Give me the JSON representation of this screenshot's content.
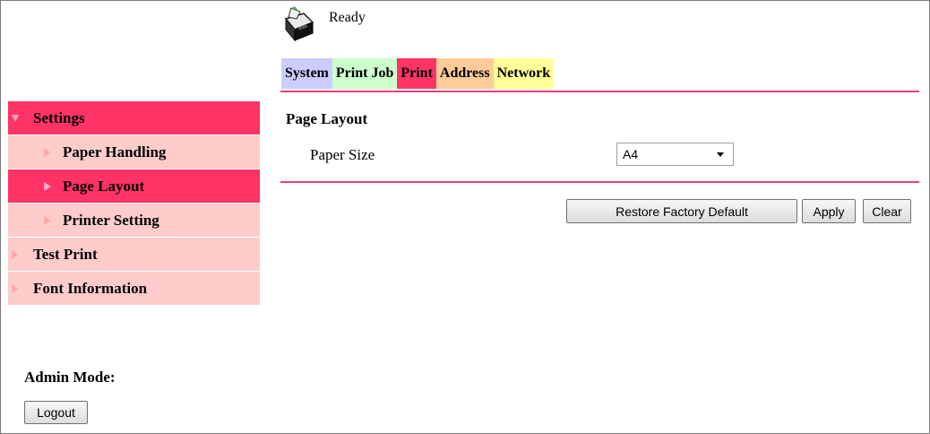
{
  "status": {
    "text": "Ready",
    "icon": "printer-status-icon"
  },
  "tabs": [
    {
      "label": "System",
      "color": "#ccccff"
    },
    {
      "label": "Print Job",
      "color": "#ccffcc"
    },
    {
      "label": "Print",
      "color": "#ff3366",
      "selected": true
    },
    {
      "label": "Address",
      "color": "#ffcc99"
    },
    {
      "label": "Network",
      "color": "#ffff99"
    }
  ],
  "sidebar": {
    "items": [
      {
        "label": "Settings",
        "expanded": true
      },
      {
        "label": "Paper Handling"
      },
      {
        "label": "Page Layout",
        "selected": true
      },
      {
        "label": "Printer Setting"
      },
      {
        "label": "Test Print"
      },
      {
        "label": "Font Information"
      }
    ]
  },
  "admin": {
    "label": "Admin Mode:",
    "logout_label": "Logout"
  },
  "main": {
    "section_title": "Page Layout",
    "paper_size": {
      "label": "Paper Size",
      "value": "A4"
    },
    "buttons": {
      "restore": "Restore Factory Default",
      "apply": "Apply",
      "clear": "Clear"
    }
  },
  "colors": {
    "accent": "#ff3366",
    "rule": "#e8427a",
    "sidebar_light": "#ffcccc"
  }
}
